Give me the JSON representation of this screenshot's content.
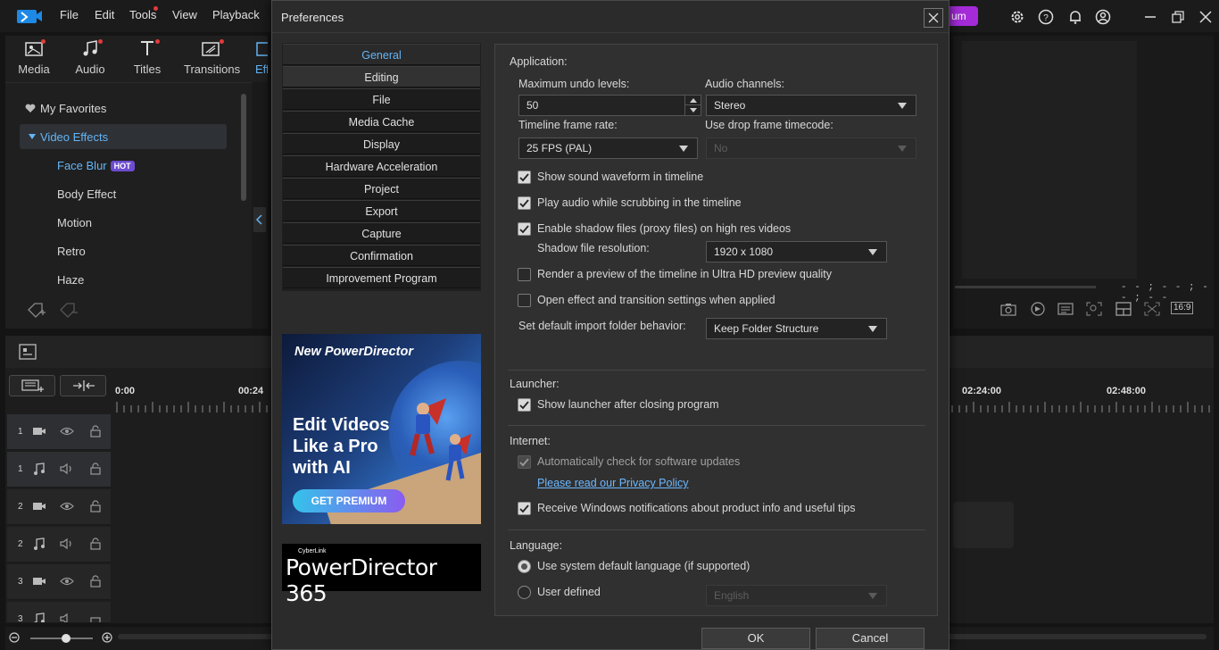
{
  "app": {
    "menu": [
      "File",
      "Edit",
      "Tools",
      "View",
      "Playback"
    ],
    "premium_label": "um",
    "room_tabs": [
      "Media",
      "Audio",
      "Titles",
      "Transitions",
      "Eff"
    ]
  },
  "effects": {
    "favorites": "My Favorites",
    "group": "Video Effects",
    "items": [
      "Face Blur",
      "Body Effect",
      "Motion",
      "Retro",
      "Haze"
    ],
    "hot_badge": "HOT"
  },
  "preview": {
    "timecode": "- - ; - - ; - - ; - -",
    "aspect_ratio": "16:9"
  },
  "timeline": {
    "ruler": [
      "0:00",
      "00:24",
      "02:24:00",
      "02:48:00"
    ],
    "tracks": [
      {
        "num": "1",
        "kind": "video"
      },
      {
        "num": "1",
        "kind": "audio"
      },
      {
        "num": "2",
        "kind": "video"
      },
      {
        "num": "2",
        "kind": "audio"
      },
      {
        "num": "3",
        "kind": "video"
      },
      {
        "num": "3",
        "kind": "audio"
      }
    ]
  },
  "dialog": {
    "title": "Preferences",
    "categories": [
      "General",
      "Editing",
      "File",
      "Media Cache",
      "Display",
      "Hardware Acceleration",
      "Project",
      "Export",
      "Capture",
      "Confirmation",
      "Improvement Program"
    ],
    "active_category": "General",
    "promo": {
      "title": "New PowerDirector",
      "headline": "Edit Videos Like a Pro with AI",
      "button": "GET PREMIUM"
    },
    "brand": {
      "sub": "CyberLink",
      "name": "PowerDirector 365"
    },
    "application": {
      "title": "Application:",
      "undo_label": "Maximum undo levels:",
      "undo_value": "50",
      "audio_channels_label": "Audio channels:",
      "audio_channels_value": "Stereo",
      "frame_rate_label": "Timeline frame rate:",
      "frame_rate_value": "25 FPS (PAL)",
      "drop_frame_label": "Use drop frame timecode:",
      "drop_frame_value": "No",
      "show_waveform": "Show sound waveform in timeline",
      "play_audio_scrub": "Play audio while scrubbing in the timeline",
      "shadow_files": "Enable shadow files (proxy files) on high res videos",
      "shadow_res_label": "Shadow file resolution:",
      "shadow_res_value": "1920 x 1080",
      "render_preview": "Render a preview of the timeline in Ultra HD preview quality",
      "open_effect_settings": "Open effect and transition settings when applied",
      "import_folder_label": "Set default import folder behavior:",
      "import_folder_value": "Keep Folder Structure"
    },
    "launcher": {
      "title": "Launcher:",
      "show_launcher": "Show launcher after closing program"
    },
    "internet": {
      "title": "Internet:",
      "auto_update": "Automatically check for software updates",
      "privacy_link": "Please read our Privacy Policy",
      "windows_notifications": "Receive Windows notifications about product info and useful tips"
    },
    "language": {
      "title": "Language:",
      "system_default": "Use system default language (if supported)",
      "user_defined": "User defined",
      "user_defined_value": "English"
    },
    "ok": "OK",
    "cancel": "Cancel"
  },
  "colors": {
    "accent": "#64b5f6",
    "link": "#6cb8ff",
    "premium": "#a52bd9"
  }
}
